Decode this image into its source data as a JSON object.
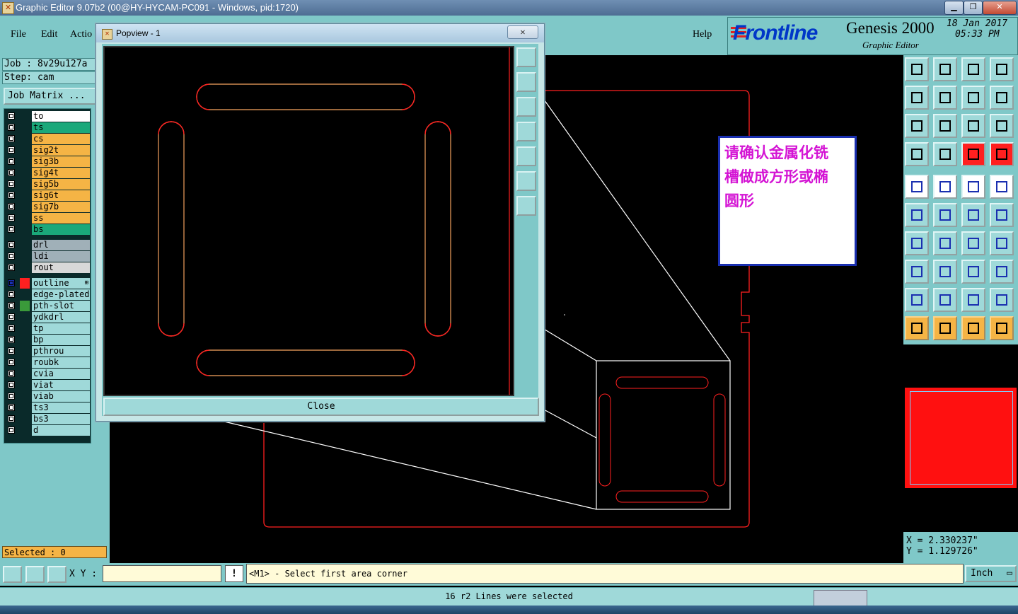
{
  "window": {
    "title": "Graphic Editor 9.07b2 (00@HY-HYCAM-PC091 - Windows, pid:1720)"
  },
  "menu": {
    "items": [
      "File",
      "Edit",
      "Actio"
    ],
    "help": "Help"
  },
  "brand": {
    "logo": "Frontline",
    "product": "Genesis 2000",
    "subtitle": "Graphic Editor",
    "date": "18 Jan 2017",
    "time": "05:33 PM"
  },
  "job": {
    "job_label": "Job : 8v29u127a",
    "step_label": "Step: cam",
    "matrix_button": "Job Matrix ..."
  },
  "layers": [
    {
      "name": "to",
      "bg": "#ffffff",
      "color": "#000000"
    },
    {
      "name": "ts",
      "bg": "#1aa87a",
      "color": "#000000"
    },
    {
      "name": "cs",
      "bg": "#f5b445",
      "color": "#000000"
    },
    {
      "name": "sig2t",
      "bg": "#f5b445",
      "color": "#000000"
    },
    {
      "name": "sig3b",
      "bg": "#f5b445",
      "color": "#000000"
    },
    {
      "name": "sig4t",
      "bg": "#f5b445",
      "color": "#000000"
    },
    {
      "name": "sig5b",
      "bg": "#f5b445",
      "color": "#000000"
    },
    {
      "name": "sig6t",
      "bg": "#f5b445",
      "color": "#000000"
    },
    {
      "name": "sig7b",
      "bg": "#f5b445",
      "color": "#000000"
    },
    {
      "name": "ss",
      "bg": "#f5b445",
      "color": "#000000"
    },
    {
      "name": "bs",
      "bg": "#1aa87a",
      "color": "#000000"
    },
    {
      "name": "drl",
      "bg": "#a0b0b8",
      "color": "#000000"
    },
    {
      "name": "ldi",
      "bg": "#a0b0b8",
      "color": "#000000"
    },
    {
      "name": "rout",
      "bg": "#d8d8d8",
      "color": "#000000"
    },
    {
      "name": "outline",
      "bg": "#9fd9d9",
      "color": "#ff2020",
      "affected": true
    },
    {
      "name": "edge-plated",
      "bg": "#9fd9d9",
      "color": "#000000"
    },
    {
      "name": "pth-slot",
      "bg": "#9fd9d9",
      "color": "#3a9a3a"
    },
    {
      "name": "ydkdrl",
      "bg": "#9fd9d9",
      "color": "#000000"
    },
    {
      "name": "tp",
      "bg": "#9fd9d9",
      "color": "#000000"
    },
    {
      "name": "bp",
      "bg": "#9fd9d9",
      "color": "#000000"
    },
    {
      "name": "pthrou",
      "bg": "#9fd9d9",
      "color": "#000000"
    },
    {
      "name": "roubk",
      "bg": "#9fd9d9",
      "color": "#000000"
    },
    {
      "name": "cvia",
      "bg": "#9fd9d9",
      "color": "#000000"
    },
    {
      "name": "viat",
      "bg": "#9fd9d9",
      "color": "#000000"
    },
    {
      "name": "viab",
      "bg": "#9fd9d9",
      "color": "#000000"
    },
    {
      "name": "ts3",
      "bg": "#9fd9d9",
      "color": "#000000"
    },
    {
      "name": "bs3",
      "bg": "#9fd9d9",
      "color": "#000000"
    },
    {
      "name": "d",
      "bg": "#9fd9d9",
      "color": "#000000"
    }
  ],
  "selected": "Selected : 0",
  "popview": {
    "title": "Popview - 1",
    "close_x": "✕",
    "close_button": "Close"
  },
  "note": {
    "line1": "请确认金属化铣",
    "line2": "槽做成方形或椭",
    "line3": "圆形"
  },
  "coords": {
    "x": "X = 2.330237\"",
    "y": "Y = 1.129726\""
  },
  "bottom": {
    "xy_label": "X Y :",
    "xy_value": "",
    "excl": "!",
    "prompt": "<M1> - Select first area corner",
    "unit": "Inch"
  },
  "status": "16 r2 Lines were selected",
  "colors": {
    "panel": "#7fc8c8",
    "outline": "#ff2020",
    "slot": "#d08a50",
    "note": "#d414d4"
  }
}
